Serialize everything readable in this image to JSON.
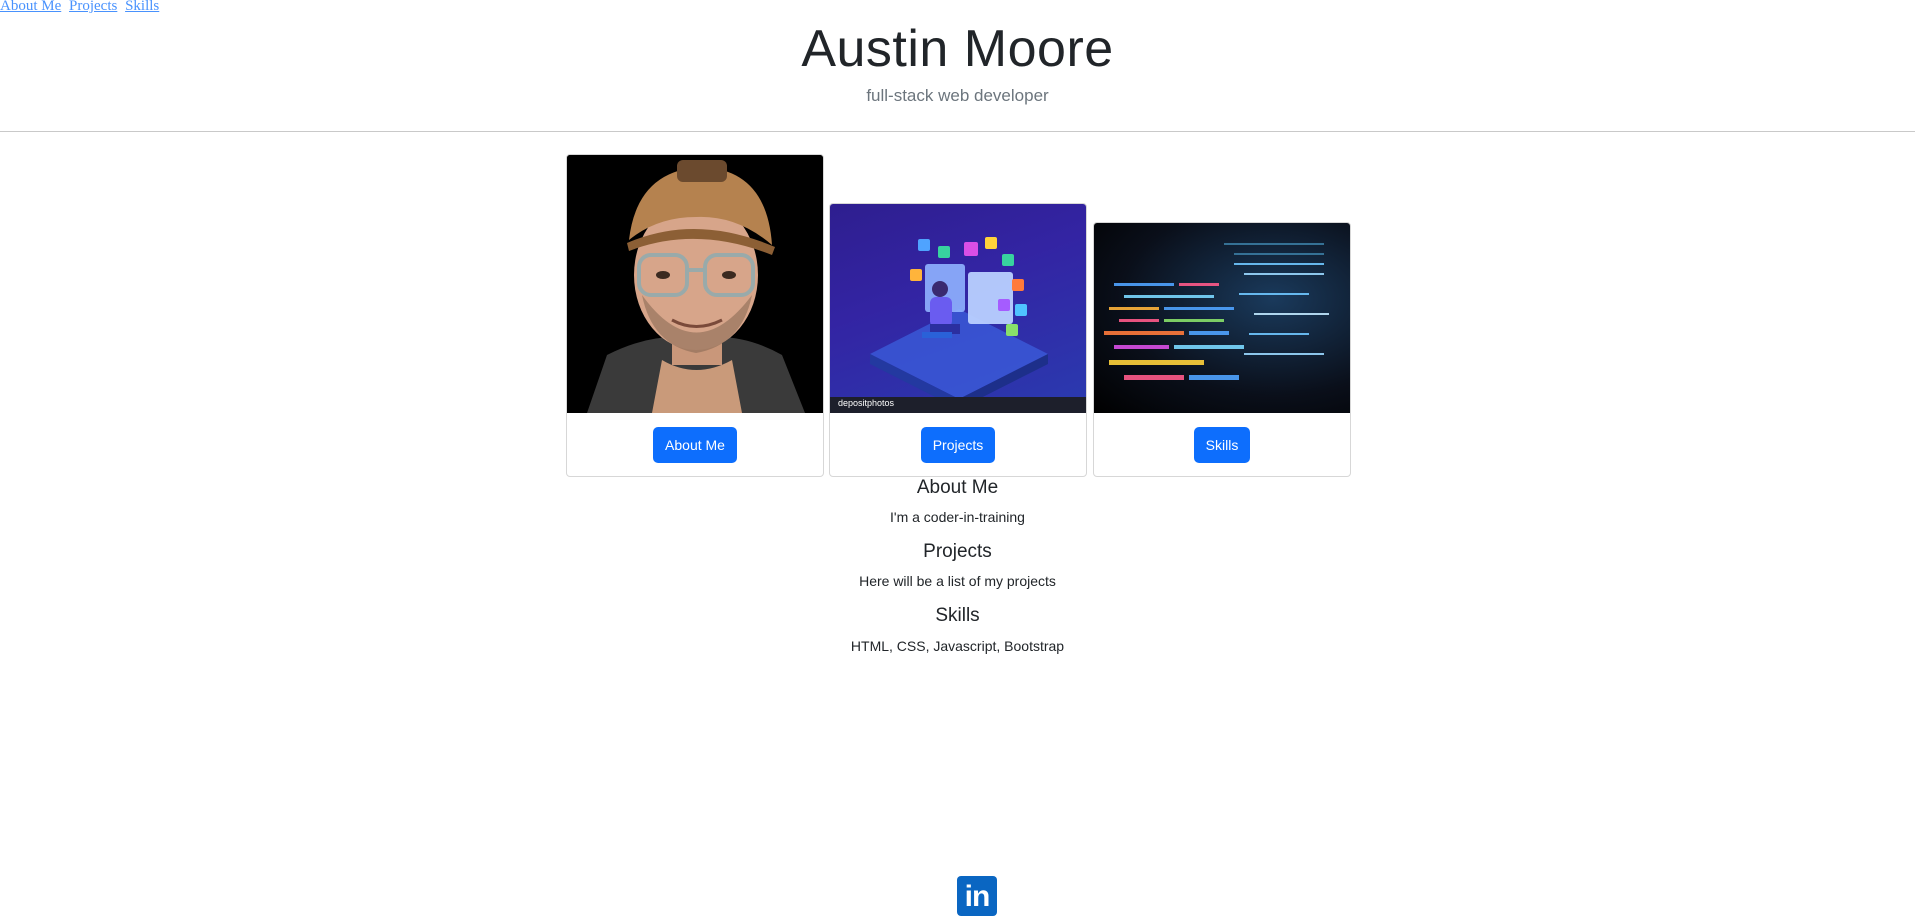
{
  "nav": {
    "links": [
      "About Me",
      "Projects",
      "Skills"
    ]
  },
  "header": {
    "name": "Austin Moore",
    "tagline": "full-stack web developer"
  },
  "cards": [
    {
      "image": "portrait-photo",
      "button": "About Me"
    },
    {
      "image": "developer-illustration",
      "button": "Projects",
      "watermark": "depositphotos"
    },
    {
      "image": "code-screen-photo",
      "button": "Skills"
    }
  ],
  "sections": [
    {
      "title": "About Me",
      "text": "I'm a coder-in-training"
    },
    {
      "title": "Projects",
      "text": "Here will be a list of my projects"
    },
    {
      "title": "Skills",
      "text": "HTML, CSS, Javascript, Bootstrap"
    }
  ],
  "footer": {
    "social_icon": "linkedin-icon",
    "linkedin_glyph": "in"
  },
  "colors": {
    "primary": "#0d6efd",
    "linkedin": "#0a66c2"
  }
}
